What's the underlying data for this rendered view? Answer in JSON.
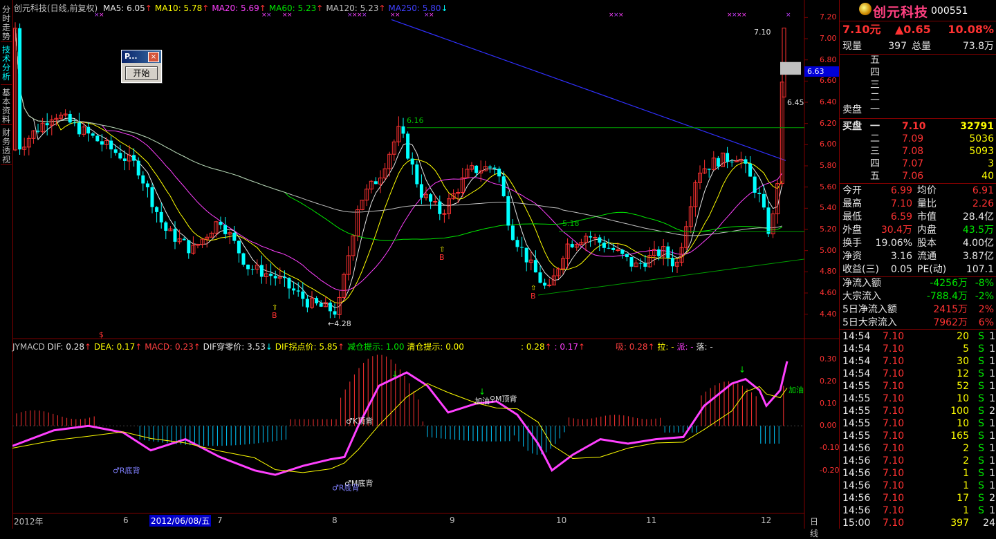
{
  "left_tabs": [
    {
      "label": "分时走势",
      "active": false
    },
    {
      "label": "技术分析",
      "active": true
    },
    {
      "label": "基本资料",
      "active": false
    },
    {
      "label": "财务透视",
      "active": false
    }
  ],
  "header": {
    "title": "创元科技(日线,前复权)",
    "ma": [
      {
        "label": "MA5: 6.05",
        "color": "#e6e6e6",
        "arrow": "↑"
      },
      {
        "label": "MA10: 5.78",
        "color": "#ffff00",
        "arrow": "↑"
      },
      {
        "label": "MA20: 5.69",
        "color": "#ff40ff",
        "arrow": "↑"
      },
      {
        "label": "MA60: 5.23",
        "color": "#00e600",
        "arrow": "↑"
      },
      {
        "label": "MA120: 5.23",
        "color": "#c0c0c0",
        "arrow": "↑"
      },
      {
        "label": "MA250: 5.80",
        "color": "#4040ff",
        "arrow": "↓"
      }
    ]
  },
  "dialog": {
    "title": "P...",
    "close": "×",
    "button": "开始"
  },
  "price_axis": {
    "labels": [
      "7.20",
      "7.00",
      "6.80",
      "6.60",
      "6.40",
      "6.20",
      "6.00",
      "5.80",
      "5.60",
      "5.40",
      "5.20",
      "5.00",
      "4.80",
      "4.60",
      "4.40"
    ],
    "current_tag": "6.63"
  },
  "chart_data": {
    "type": "candlestick",
    "price_range": [
      4.3,
      7.3
    ],
    "annotations": {
      "high_label": "7.10",
      "level_6_45": "6.45",
      "level_6_16": "6.16",
      "level_5_18": "5.18",
      "low_label": "4.28"
    },
    "buy_marks": [
      "B",
      "B",
      "B"
    ],
    "dollar_mark": "$",
    "macd_axis": [
      "0.30",
      "0.20",
      "0.10",
      "0.00",
      "-0.10",
      "-0.20"
    ],
    "macd_labels": [
      "♂R底背",
      "♂K顶背",
      "加油",
      "♀M顶背",
      "♂M底背",
      "♂R底背",
      "加油"
    ]
  },
  "macd_header": {
    "name": "JYMACD",
    "dif": "DIF: 0.28",
    "dea": "DEA: 0.17",
    "macd": "MACD: 0.23",
    "cross": "DIF穿零价: 3.53",
    "turn": "DIF拐点价: 5.85",
    "reduce": "减仓提示: 1.00",
    "clear": "清仓提示: 0.00",
    "v1": ": 0.28",
    "v2": ": 0.17",
    "xi": "吸: 0.28",
    "la": "拉: -",
    "pai": "派: -",
    "luo": "落: -"
  },
  "date_axis": {
    "labels": [
      "2012年",
      "6",
      "2012/06/08/五",
      "7",
      "8",
      "9",
      "10",
      "11",
      "12"
    ],
    "period": "日线"
  },
  "stock": {
    "name": "创元科技",
    "code": "000551",
    "price": "7.10元",
    "change": "▲0.65",
    "pct": "10.08%",
    "xianliang_label": "现量",
    "xianliang": "397",
    "zongliang_label": "总量",
    "zongliang": "73.8万",
    "sell_label": "卖盘",
    "sell": [
      "五",
      "四",
      "三",
      "二",
      "一"
    ],
    "buy_label": "买盘",
    "buy": [
      {
        "lvl": "一",
        "price": "7.10",
        "vol": "32791"
      },
      {
        "lvl": "二",
        "price": "7.09",
        "vol": "5036"
      },
      {
        "lvl": "三",
        "price": "7.08",
        "vol": "5093"
      },
      {
        "lvl": "四",
        "price": "7.07",
        "vol": "3"
      },
      {
        "lvl": "五",
        "price": "7.06",
        "vol": "40"
      }
    ],
    "stats": [
      {
        "l1": "今开",
        "v1": "6.99",
        "l2": "均价",
        "v2": "6.91",
        "c1": "red",
        "c2": "red"
      },
      {
        "l1": "最高",
        "v1": "7.10",
        "l2": "量比",
        "v2": "2.26",
        "c1": "red",
        "c2": "red"
      },
      {
        "l1": "最低",
        "v1": "6.59",
        "l2": "市值",
        "v2": "28.4亿",
        "c1": "red",
        "c2": "white"
      },
      {
        "l1": "外盘",
        "v1": "30.4万",
        "l2": "内盘",
        "v2": "43.5万",
        "c1": "red",
        "c2": "green"
      },
      {
        "l1": "换手",
        "v1": "19.06%",
        "l2": "股本",
        "v2": "4.00亿",
        "c1": "white",
        "c2": "white"
      },
      {
        "l1": "净资",
        "v1": "3.16",
        "l2": "流通",
        "v2": "3.87亿",
        "c1": "white",
        "c2": "white"
      },
      {
        "l1": "收益(三)",
        "v1": "0.05",
        "l2": "PE(动)",
        "v2": "107.1",
        "c1": "white",
        "c2": "white"
      }
    ],
    "flows": [
      {
        "label": "净流入额",
        "val": "-4256万",
        "pct": "-8%",
        "c": "green"
      },
      {
        "label": "大宗流入",
        "val": "-788.4万",
        "pct": "-2%",
        "c": "green"
      },
      {
        "label": "5日净流入额",
        "val": "2415万",
        "pct": "2%",
        "c": "red"
      },
      {
        "label": "5日大宗流入",
        "val": "7962万",
        "pct": "6%",
        "c": "red"
      }
    ],
    "ticks": [
      {
        "t": "14:54",
        "p": "7.10",
        "v": "20",
        "s": "S",
        "n": "1"
      },
      {
        "t": "14:54",
        "p": "7.10",
        "v": "5",
        "s": "S",
        "n": "1"
      },
      {
        "t": "14:54",
        "p": "7.10",
        "v": "30",
        "s": "S",
        "n": "1"
      },
      {
        "t": "14:54",
        "p": "7.10",
        "v": "12",
        "s": "S",
        "n": "1"
      },
      {
        "t": "14:55",
        "p": "7.10",
        "v": "52",
        "s": "S",
        "n": "1"
      },
      {
        "t": "14:55",
        "p": "7.10",
        "v": "10",
        "s": "S",
        "n": "1"
      },
      {
        "t": "14:55",
        "p": "7.10",
        "v": "100",
        "s": "S",
        "n": "2"
      },
      {
        "t": "14:55",
        "p": "7.10",
        "v": "10",
        "s": "S",
        "n": "1"
      },
      {
        "t": "14:55",
        "p": "7.10",
        "v": "165",
        "s": "S",
        "n": "1"
      },
      {
        "t": "14:56",
        "p": "7.10",
        "v": "2",
        "s": "S",
        "n": "1"
      },
      {
        "t": "14:56",
        "p": "7.10",
        "v": "2",
        "s": "S",
        "n": "1"
      },
      {
        "t": "14:56",
        "p": "7.10",
        "v": "1",
        "s": "S",
        "n": "1"
      },
      {
        "t": "14:56",
        "p": "7.10",
        "v": "1",
        "s": "S",
        "n": "1"
      },
      {
        "t": "14:56",
        "p": "7.10",
        "v": "17",
        "s": "S",
        "n": "2"
      },
      {
        "t": "14:56",
        "p": "7.10",
        "v": "1",
        "s": "S",
        "n": "1"
      },
      {
        "t": "15:00",
        "p": "7.10",
        "v": "397",
        "s": "",
        "n": "24"
      }
    ]
  }
}
